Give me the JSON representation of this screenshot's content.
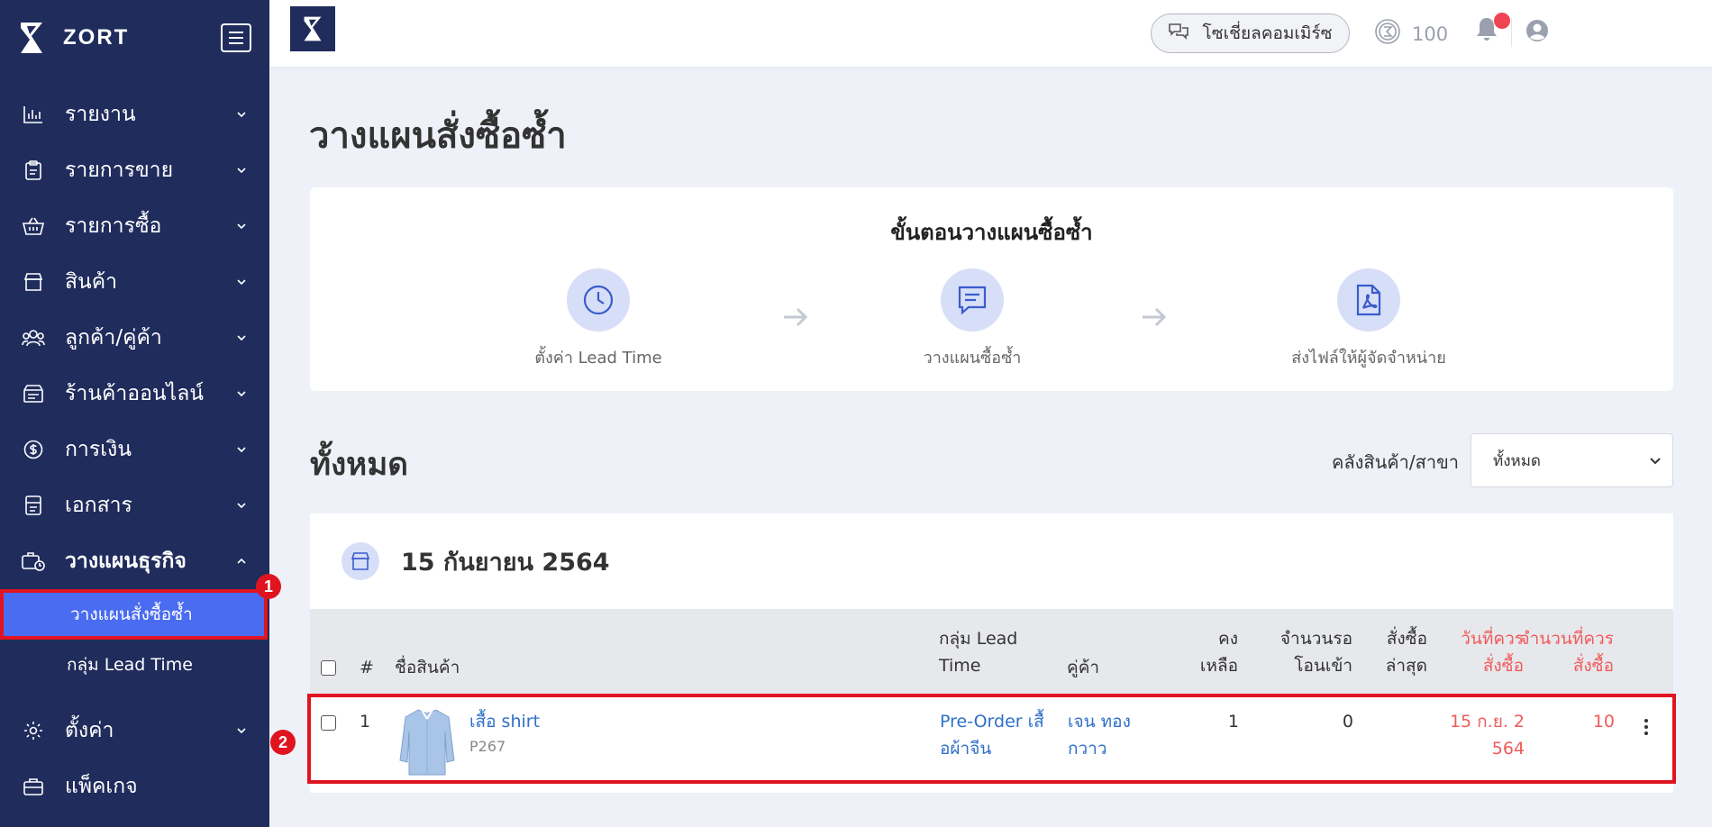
{
  "brand": {
    "name": "ZORT"
  },
  "sidebar": {
    "items": [
      {
        "label": "รายงาน",
        "icon": "bar-chart-icon"
      },
      {
        "label": "รายการขาย",
        "icon": "clipboard-icon"
      },
      {
        "label": "รายการซื้อ",
        "icon": "basket-icon"
      },
      {
        "label": "สินค้า",
        "icon": "store-icon"
      },
      {
        "label": "ลูกค้า/คู่ค้า",
        "icon": "users-icon"
      },
      {
        "label": "ร้านค้าออนไลน์",
        "icon": "online-store-icon"
      },
      {
        "label": "การเงิน",
        "icon": "coin-icon"
      },
      {
        "label": "เอกสาร",
        "icon": "document-icon"
      },
      {
        "label": "วางแผนธุรกิจ",
        "icon": "business-plan-icon"
      }
    ],
    "subitems": [
      {
        "label": "วางแผนสั่งซื้อซ้ำ"
      },
      {
        "label": "กลุ่ม Lead Time"
      }
    ],
    "bottom_items": [
      {
        "label": "ตั้งค่า",
        "icon": "gear-icon"
      },
      {
        "label": "แพ็คเกจ",
        "icon": "briefcase-icon"
      }
    ]
  },
  "markers": [
    "1",
    "2"
  ],
  "topbar": {
    "social_label": "โซเชี่ยลคอมเมิร์ซ",
    "credit": "100"
  },
  "page": {
    "title": "วางแผนสั่งซื้อซ้ำ",
    "steps_title": "ขั้นตอนวางแผนซื้อซ้ำ",
    "steps": [
      {
        "label": "ตั้งค่า Lead Time",
        "icon": "clock-icon"
      },
      {
        "label": "วางแผนซื้อซ้ำ",
        "icon": "chat-icon"
      },
      {
        "label": "ส่งไฟล์ให้ผู้จัดจำหน่าย",
        "icon": "pdf-icon"
      }
    ],
    "section_title": "ทั้งหมด",
    "filter_label": "คลังสินค้า/สาขา",
    "filter_value": "ทั้งหมด",
    "group_date": "15 กันยายน 2564"
  },
  "table": {
    "headers": {
      "no": "#",
      "name": "ชื่อสินค้า",
      "lead_1": "กลุ่ม Lead",
      "lead_2": "Time",
      "partner": "คู่ค้า",
      "remain_1": "คง",
      "remain_2": "เหลือ",
      "incoming_1": "จำนวนรอ",
      "incoming_2": "โอนเข้า",
      "last_1": "สั่งซื้อ",
      "last_2": "ล่าสุด",
      "orderdate_1": "วันที่ควร",
      "orderdate_2": "สั่งซื้อ",
      "orderqty_1": "จำนวนที่ควร",
      "orderqty_2": "สั่งซื้อ"
    },
    "rows": [
      {
        "no": "1",
        "name": "เสื้อ shirt",
        "sku": "P267",
        "lead_1": "Pre-Order เสื้",
        "lead_2": "อผ้าจีน",
        "partner_1": "เจน ทอง",
        "partner_2": "กวาว",
        "remain": "1",
        "incoming": "0",
        "orderdate_1": "15 ก.ย. 2",
        "orderdate_2": "564",
        "orderqty": "10"
      }
    ]
  },
  "colors": {
    "sidebar": "#1f2c5c",
    "active": "#4a6cf0",
    "highlight": "#e0141f",
    "accent_red": "#f15b5b",
    "link": "#2f6fc9"
  }
}
